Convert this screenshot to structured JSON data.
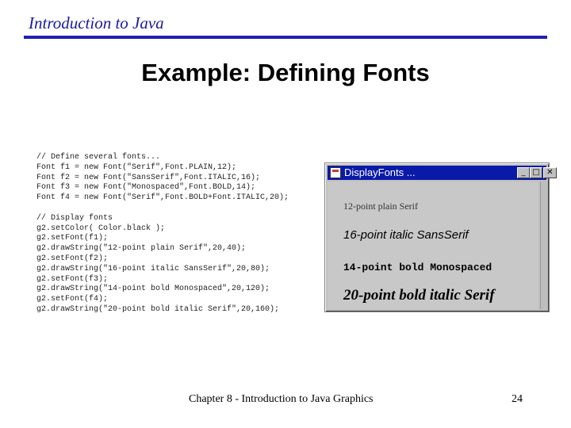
{
  "header": {
    "title": "Introduction to Java"
  },
  "slide": {
    "title": "Example: Defining Fonts"
  },
  "code": {
    "lines": [
      "// Define several fonts...",
      "Font f1 = new Font(\"Serif\",Font.PLAIN,12);",
      "Font f2 = new Font(\"SansSerif\",Font.ITALIC,16);",
      "Font f3 = new Font(\"Monospaced\",Font.BOLD,14);",
      "Font f4 = new Font(\"Serif\",Font.BOLD+Font.ITALIC,20);",
      "",
      "// Display fonts",
      "g2.setColor( Color.black );",
      "g2.setFont(f1);",
      "g2.drawString(\"12-point plain Serif\",20,40);",
      "g2.setFont(f2);",
      "g2.drawString(\"16-point italic SansSerif\",20,80);",
      "g2.setFont(f3);",
      "g2.drawString(\"14-point bold Monospaced\",20,120);",
      "g2.setFont(f4);",
      "g2.drawString(\"20-point bold italic Serif\",20,160);"
    ]
  },
  "window": {
    "title": "DisplayFonts ...",
    "icon": "app-icon",
    "minimize_label": "_",
    "maximize_label": "□",
    "close_label": "✕",
    "samples": [
      "12-point plain Serif",
      "16-point italic SansSerif",
      "14-point bold Monospaced",
      "20-point bold italic Serif"
    ],
    "colors": {
      "title_bar": "#0a1aa8",
      "face": "#c0c0c0"
    }
  },
  "footer": {
    "text": "Chapter 8 - Introduction to Java Graphics",
    "page_number": "24"
  },
  "colors": {
    "accent": "#2121b0",
    "header_text": "#1a1aa0"
  }
}
